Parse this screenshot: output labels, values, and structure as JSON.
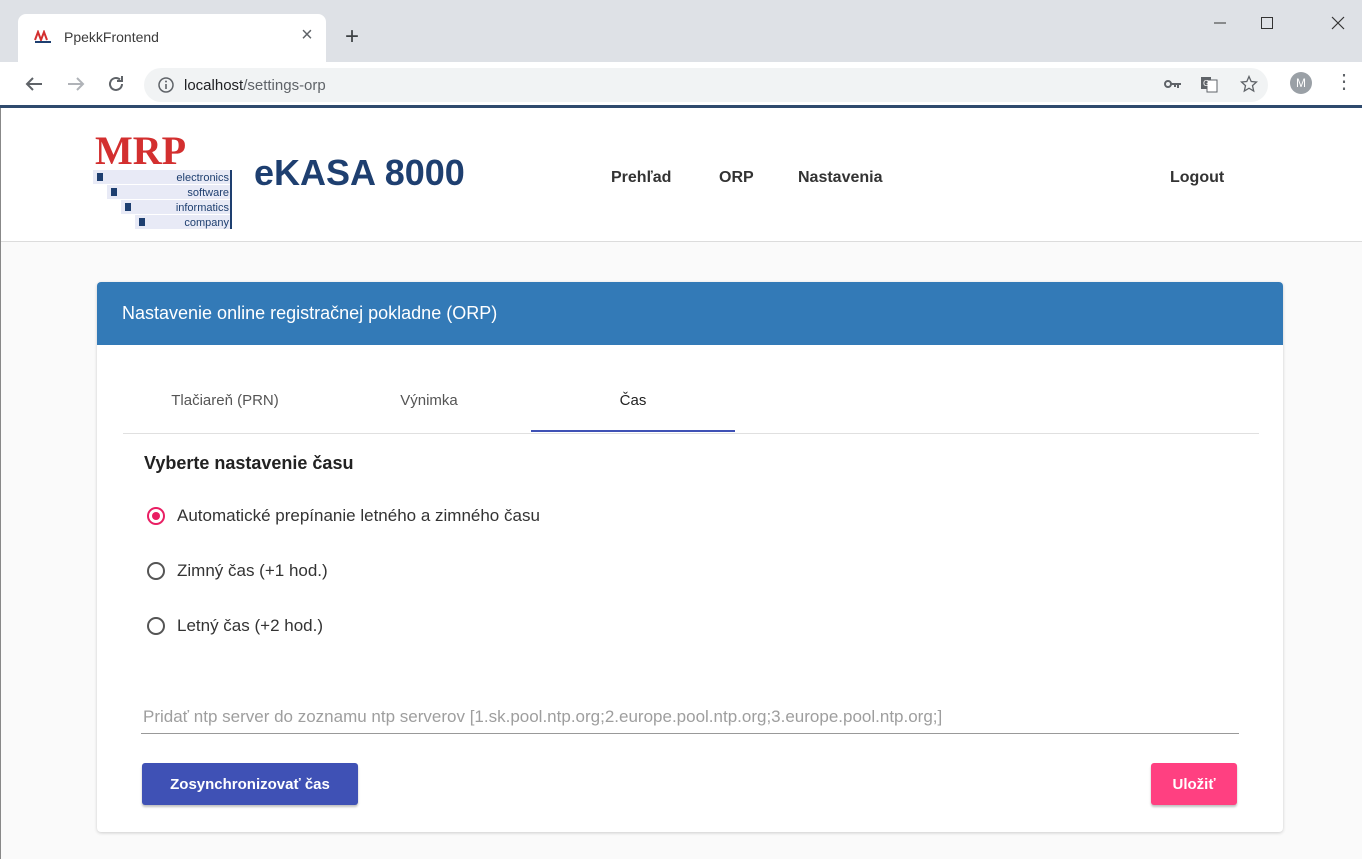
{
  "browser": {
    "tab_title": "PpekkFrontend",
    "url_host": "localhost",
    "url_path": "/settings-orp",
    "profile_initial": "M",
    "new_tab_label": "+",
    "close_tab_label": "×"
  },
  "header": {
    "logo_text": "MRP",
    "logo_lines": [
      "electronics",
      "software",
      "informatics",
      "company"
    ],
    "brand": "eKASA 8000",
    "nav": [
      "Prehľad",
      "ORP",
      "Nastavenia"
    ],
    "logout": "Logout"
  },
  "card": {
    "title": "Nastavenie online registračnej pokladne (ORP)",
    "tabs": [
      "Tlačiareň (PRN)",
      "Výnimka",
      "Čas"
    ],
    "active_tab": "Čas",
    "section_title": "Vyberte nastavenie času",
    "options": [
      {
        "label": "Automatické prepínanie letného a zimného času",
        "checked": true
      },
      {
        "label": "Zimný čas (+1 hod.)",
        "checked": false
      },
      {
        "label": "Letný čas (+2 hod.)",
        "checked": false
      }
    ],
    "ntp_placeholder": "Pridať ntp server do zoznamu ntp serverov [1.sk.pool.ntp.org;2.europe.pool.ntp.org;3.europe.pool.ntp.org;]",
    "ntp_value": "",
    "sync_button": "Zosynchronizovať čas",
    "save_button": "Uložiť"
  },
  "colors": {
    "header_blue": "#337ab7",
    "brand_navy": "#1e3f70",
    "primary": "#3f51b5",
    "accent": "#ff4081",
    "radio_checked": "#e91e63"
  }
}
